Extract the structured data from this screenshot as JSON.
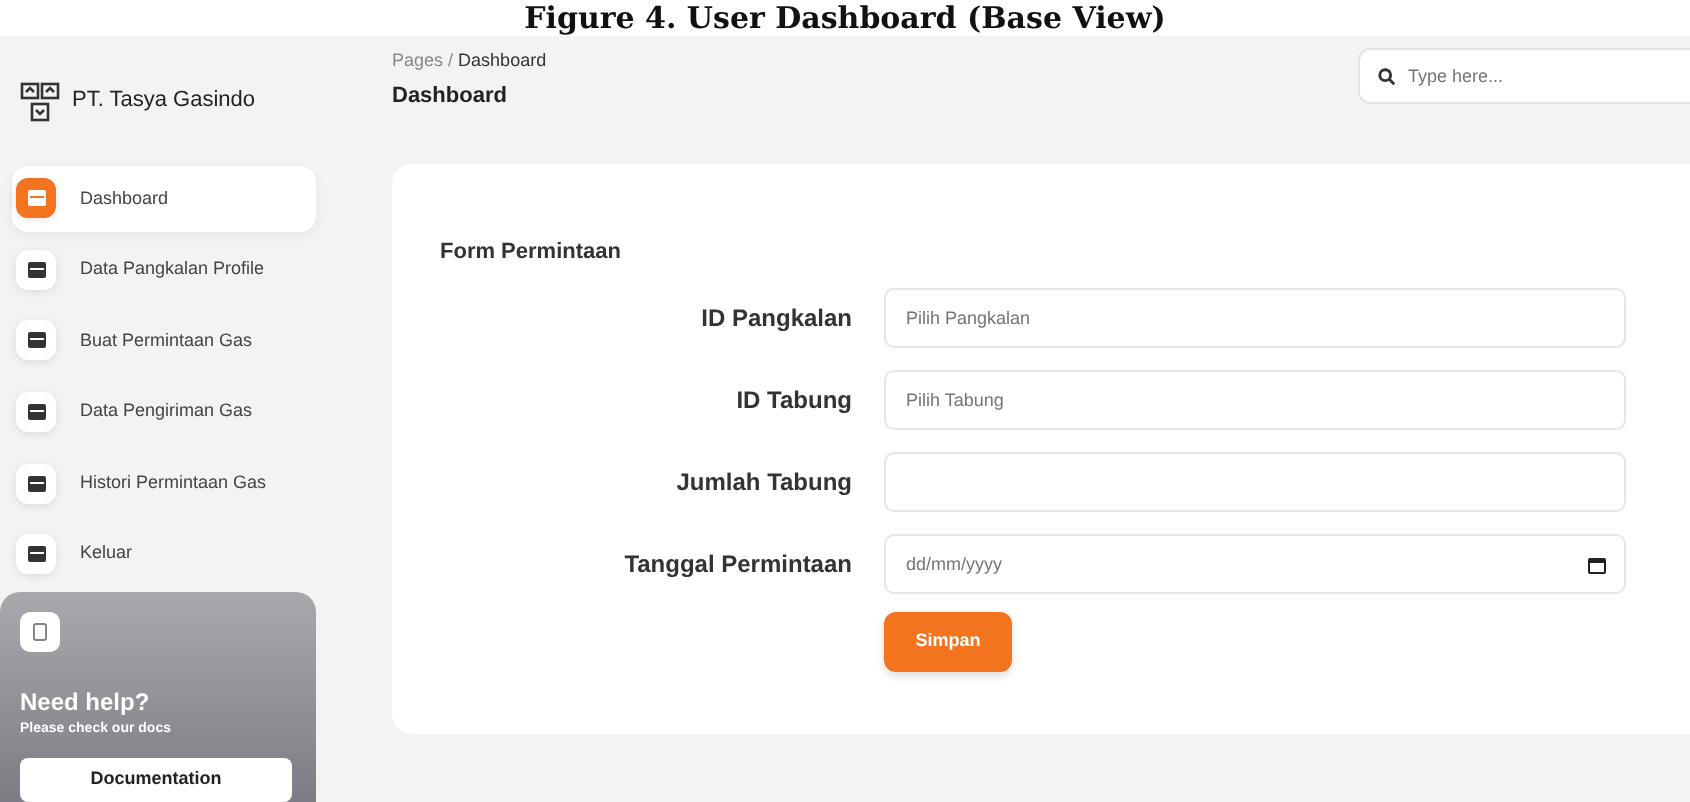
{
  "caption": "Figure 4. User Dashboard (Base View)",
  "brand": {
    "name": "PT. Tasya Gasindo"
  },
  "sidebar": {
    "items": [
      {
        "label": "Dashboard",
        "selected": true
      },
      {
        "label": "Data Pangkalan Profile",
        "selected": false
      },
      {
        "label": "Buat Permintaan Gas",
        "selected": false
      },
      {
        "label": "Data Pengiriman Gas",
        "selected": false
      },
      {
        "label": "Histori Permintaan Gas",
        "selected": false
      },
      {
        "label": "Keluar",
        "selected": false
      }
    ]
  },
  "help_card": {
    "title": "Need help?",
    "subtitle": "Please check our docs",
    "button": "Documentation"
  },
  "breadcrumb": {
    "items": [
      "Pages",
      "Dashboard"
    ],
    "separator": "/"
  },
  "page_title": "Dashboard",
  "search": {
    "placeholder": "Type here..."
  },
  "form": {
    "title": "Form Permintaan",
    "fields": [
      {
        "label": "ID Pangkalan",
        "kind": "select",
        "placeholder": "Pilih Pangkalan"
      },
      {
        "label": "ID Tabung",
        "kind": "select",
        "placeholder": "Pilih Tabung"
      },
      {
        "label": "Jumlah Tabung",
        "kind": "text"
      },
      {
        "label": "Tanggal Permintaan",
        "kind": "date",
        "placeholder": "dd/mm/yyyy"
      }
    ],
    "submit": "Simpan"
  }
}
